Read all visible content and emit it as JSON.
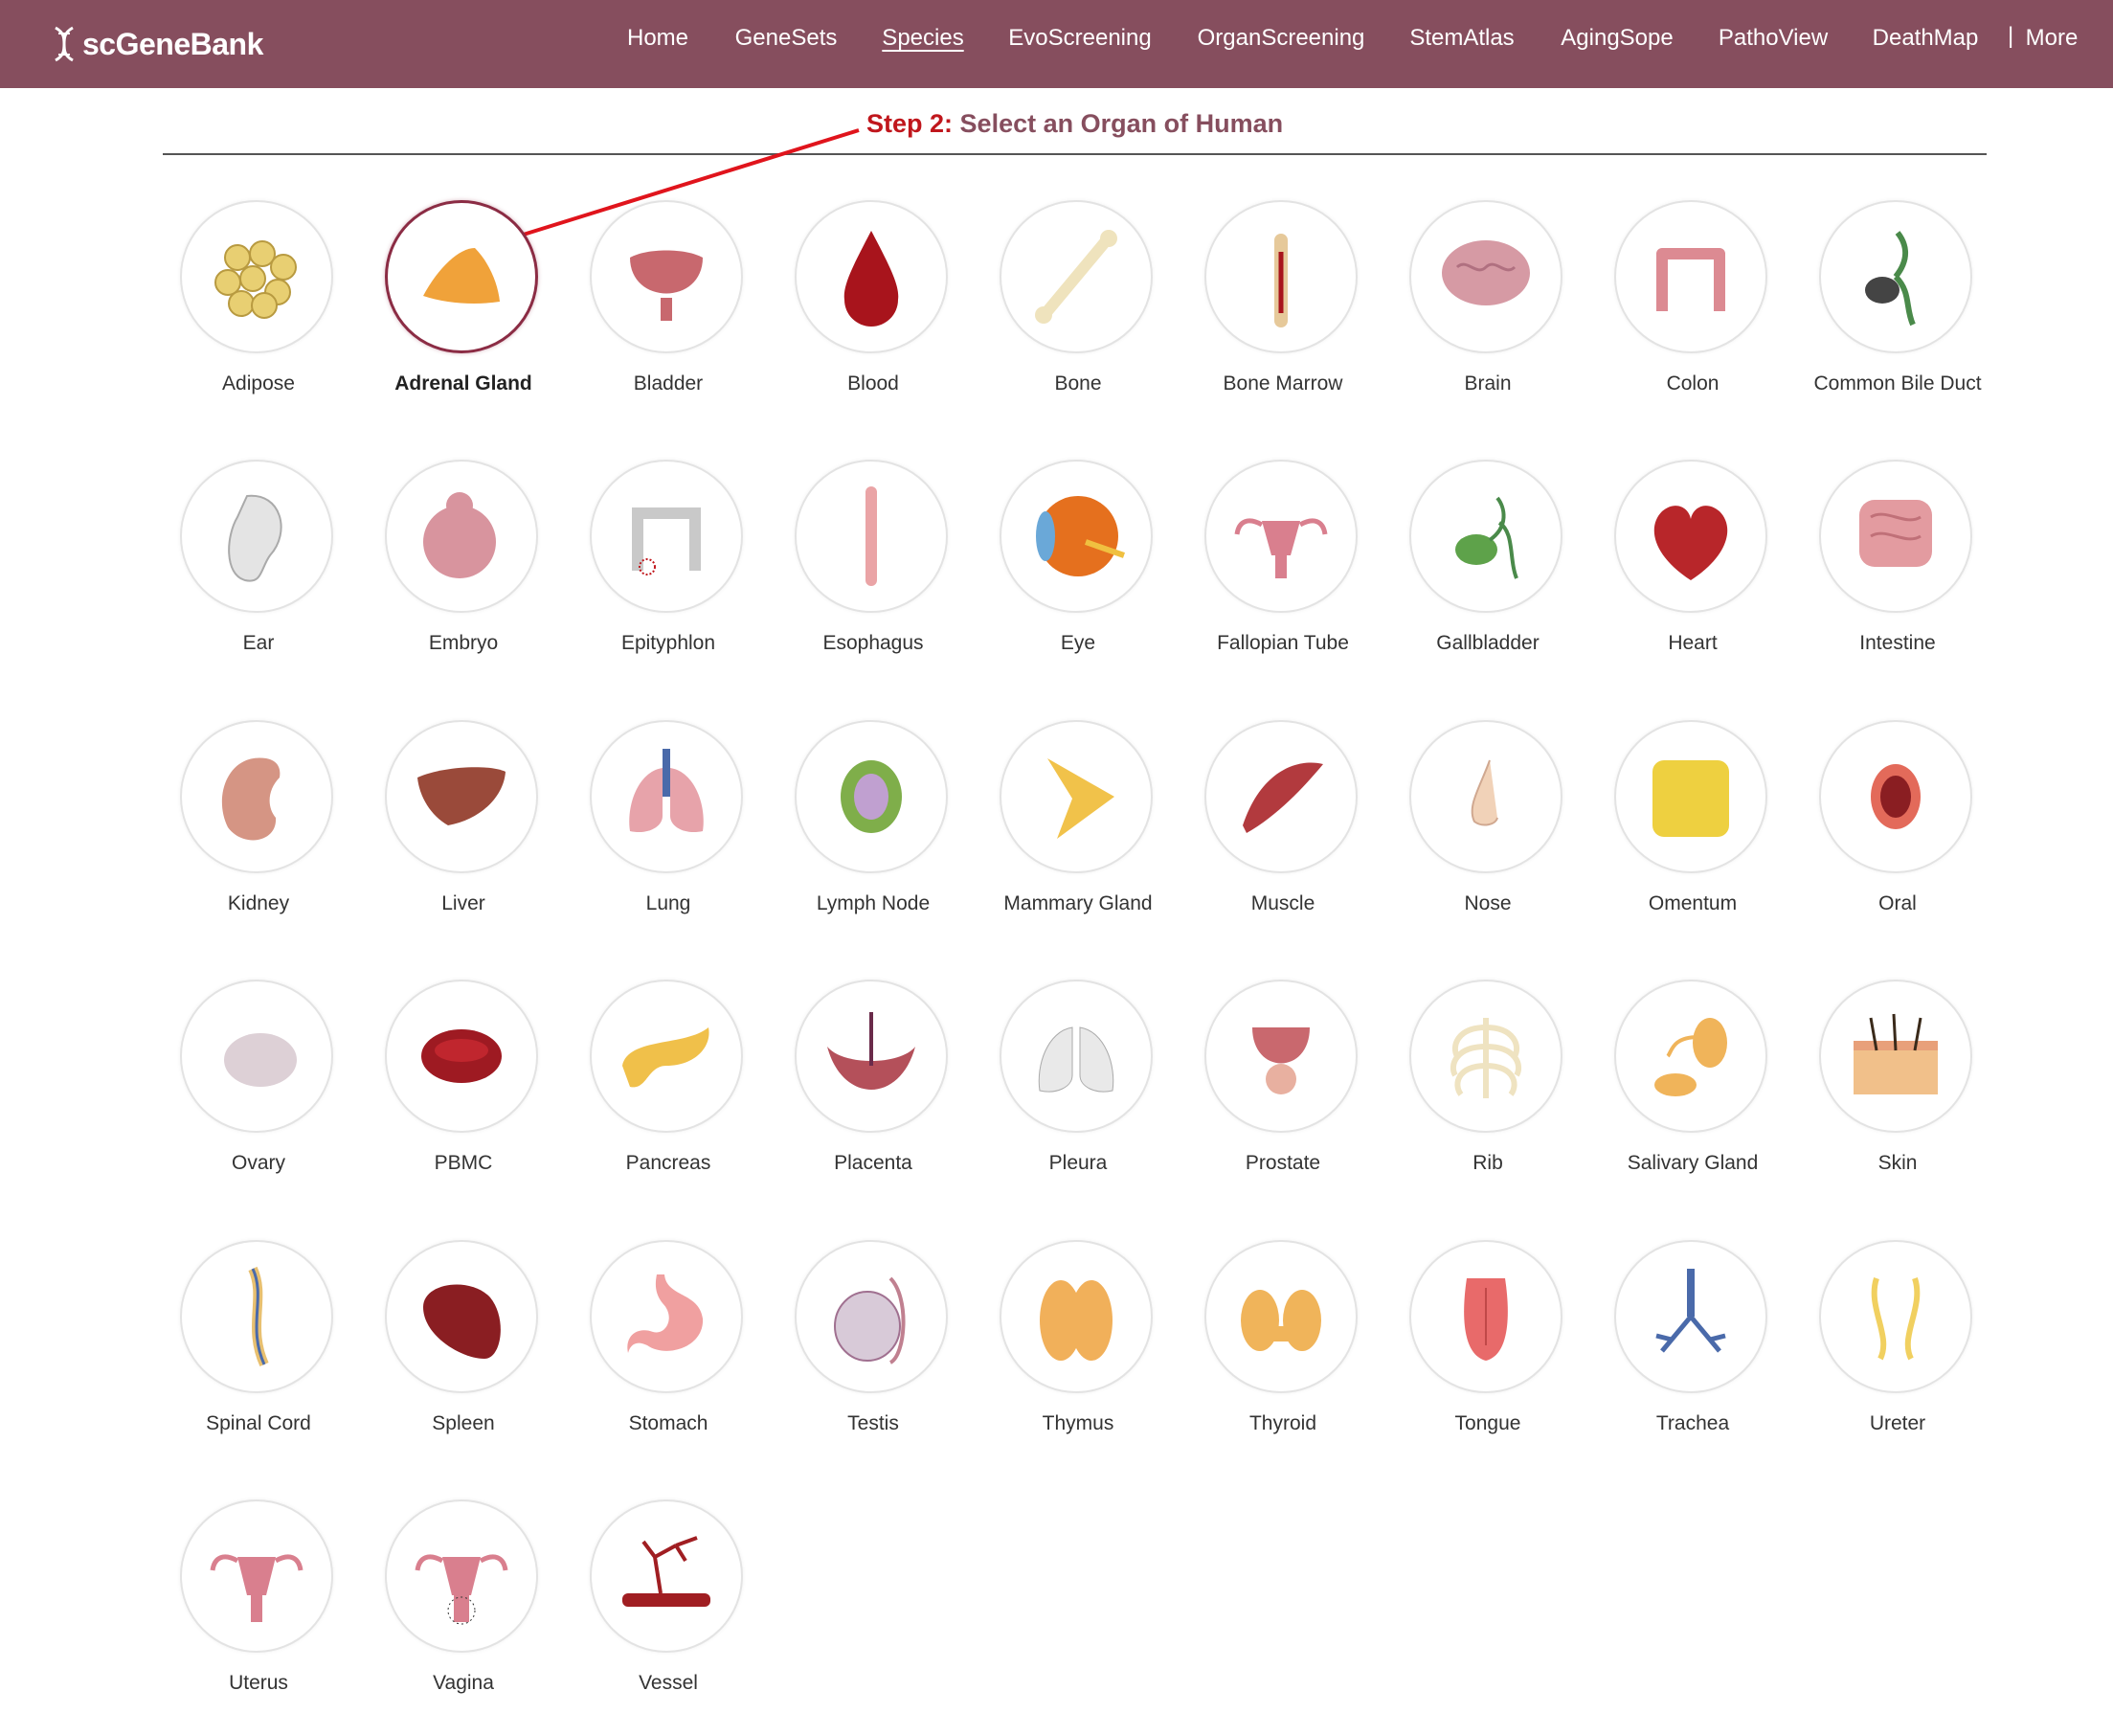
{
  "nav": {
    "brand": "scGeneBank",
    "items": [
      {
        "label": "Home",
        "active": false
      },
      {
        "label": "GeneSets",
        "active": false
      },
      {
        "label": "Species",
        "active": true
      },
      {
        "label": "EvoScreening",
        "active": false
      },
      {
        "label": "OrganScreening",
        "active": false
      },
      {
        "label": "StemAtlas",
        "active": false
      },
      {
        "label": "AgingSope",
        "active": false
      },
      {
        "label": "PathoView",
        "active": false
      },
      {
        "label": "DeathMap",
        "active": false
      }
    ],
    "separator": "|",
    "more": "More"
  },
  "step": {
    "prefix": "Step 2:",
    "text": "Select an Organ of Human"
  },
  "selected_organ": "Adrenal Gland",
  "colors": {
    "navbar": "#864e5e",
    "accent_red": "#c0161c",
    "title": "#864e5e",
    "selected_ring": "#8b2c44"
  },
  "organs": [
    {
      "label": "Adipose",
      "icon": "adipose-icon",
      "color": "#e8cf72"
    },
    {
      "label": "Adrenal Gland",
      "icon": "adrenal-gland-icon",
      "color": "#f0a23a"
    },
    {
      "label": "Bladder",
      "icon": "bladder-icon",
      "color": "#c8686e"
    },
    {
      "label": "Blood",
      "icon": "blood-drop-icon",
      "color": "#a8141c"
    },
    {
      "label": "Bone",
      "icon": "bone-icon",
      "color": "#efe3bd"
    },
    {
      "label": "Bone Marrow",
      "icon": "bone-marrow-icon",
      "color": "#e6c99a"
    },
    {
      "label": "Brain",
      "icon": "brain-icon",
      "color": "#d69aa4"
    },
    {
      "label": "Colon",
      "icon": "colon-icon",
      "color": "#dc8a92"
    },
    {
      "label": "Common Bile Duct",
      "icon": "bile-duct-icon",
      "color": "#4a8a4a"
    },
    {
      "label": "Ear",
      "icon": "ear-icon",
      "color": "#e4e4e4"
    },
    {
      "label": "Embryo",
      "icon": "embryo-icon",
      "color": "#d8949e"
    },
    {
      "label": "Epityphlon",
      "icon": "epityphlon-icon",
      "color": "#c9c9c9"
    },
    {
      "label": "Esophagus",
      "icon": "esophagus-icon",
      "color": "#eaa4a6"
    },
    {
      "label": "Eye",
      "icon": "eye-icon",
      "color": "#e5701e"
    },
    {
      "label": "Fallopian Tube",
      "icon": "fallopian-tube-icon",
      "color": "#d97f8e"
    },
    {
      "label": "Gallbladder",
      "icon": "gallbladder-icon",
      "color": "#5ea24a"
    },
    {
      "label": "Heart",
      "icon": "heart-icon",
      "color": "#b8262a"
    },
    {
      "label": "Intestine",
      "icon": "intestine-icon",
      "color": "#e39ba0"
    },
    {
      "label": "Kidney",
      "icon": "kidney-icon",
      "color": "#d59584"
    },
    {
      "label": "Liver",
      "icon": "liver-icon",
      "color": "#9a4a3a"
    },
    {
      "label": "Lung",
      "icon": "lung-icon",
      "color": "#e7a3aa"
    },
    {
      "label": "Lymph Node",
      "icon": "lymph-node-icon",
      "color": "#7fae4a"
    },
    {
      "label": "Mammary Gland",
      "icon": "mammary-gland-icon",
      "color": "#f1c24a"
    },
    {
      "label": "Muscle",
      "icon": "muscle-icon",
      "color": "#b23a3e"
    },
    {
      "label": "Nose",
      "icon": "nose-icon",
      "color": "#f1d2b8"
    },
    {
      "label": "Omentum",
      "icon": "omentum-icon",
      "color": "#eed040"
    },
    {
      "label": "Oral",
      "icon": "oral-icon",
      "color": "#e36a5a"
    },
    {
      "label": "Ovary",
      "icon": "ovary-icon",
      "color": "#ddd0d6"
    },
    {
      "label": "PBMC",
      "icon": "pbmc-icon",
      "color": "#9e1a22"
    },
    {
      "label": "Pancreas",
      "icon": "pancreas-icon",
      "color": "#f0c04a"
    },
    {
      "label": "Placenta",
      "icon": "placenta-icon",
      "color": "#b4505a"
    },
    {
      "label": "Pleura",
      "icon": "pleura-icon",
      "color": "#e9e9e9"
    },
    {
      "label": "Prostate",
      "icon": "prostate-icon",
      "color": "#c9686e"
    },
    {
      "label": "Rib",
      "icon": "rib-icon",
      "color": "#efe3c1"
    },
    {
      "label": "Salivary Gland",
      "icon": "salivary-gland-icon",
      "color": "#f0b45a"
    },
    {
      "label": "Skin",
      "icon": "skin-icon",
      "color": "#f1c08a"
    },
    {
      "label": "Spinal Cord",
      "icon": "spinal-cord-icon",
      "color": "#e8c070"
    },
    {
      "label": "Spleen",
      "icon": "spleen-icon",
      "color": "#8a1e22"
    },
    {
      "label": "Stomach",
      "icon": "stomach-icon",
      "color": "#f0a0a0"
    },
    {
      "label": "Testis",
      "icon": "testis-icon",
      "color": "#d8cad8"
    },
    {
      "label": "Thymus",
      "icon": "thymus-icon",
      "color": "#f1b05a"
    },
    {
      "label": "Thyroid",
      "icon": "thyroid-icon",
      "color": "#f0b45a"
    },
    {
      "label": "Tongue",
      "icon": "tongue-icon",
      "color": "#e86a6a"
    },
    {
      "label": "Trachea",
      "icon": "trachea-icon",
      "color": "#4a6aaa"
    },
    {
      "label": "Ureter",
      "icon": "ureter-icon",
      "color": "#f1d060"
    },
    {
      "label": "Uterus",
      "icon": "uterus-icon",
      "color": "#d97f8e"
    },
    {
      "label": "Vagina",
      "icon": "vagina-icon",
      "color": "#d97f8e"
    },
    {
      "label": "Vessel",
      "icon": "vessel-icon",
      "color": "#a01e22"
    }
  ]
}
